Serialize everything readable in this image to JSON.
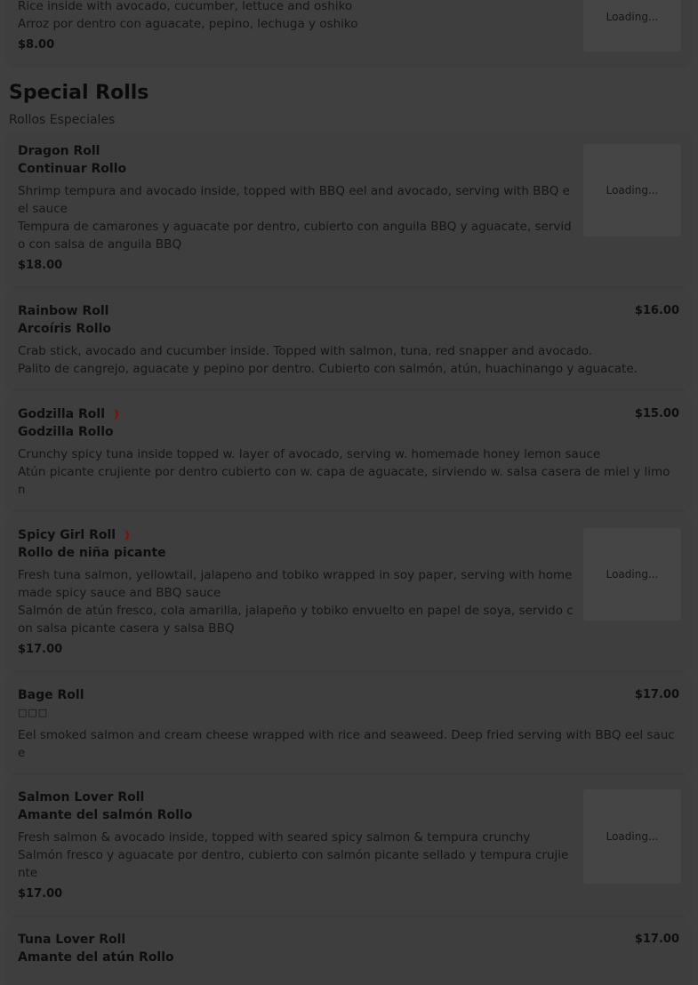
{
  "top_item": {
    "desc_en": "Rice inside with avocado, cucumber, lettuce and oshiko",
    "desc_es": "Arroz por dentro con aguacate, pepino, lechuga y oshiko",
    "price": "$8.00",
    "image_status": "Loading..."
  },
  "section": {
    "title": "Special Rolls",
    "subtitle": "Rollos Especiales"
  },
  "items": [
    {
      "name": "Dragon Roll",
      "name_alt": "Continuar Rollo",
      "desc_en": "Shrimp tempura and avocado inside, topped with BBQ eel and avocado, serving with BBQ eel sauce",
      "desc_es": "Tempura de camarones y aguacate por dentro, cubierto con anguila BBQ y aguacate, servido con salsa de anguila BBQ",
      "price": "$18.00",
      "image_status": "Loading..."
    },
    {
      "name": "Rainbow Roll",
      "name_alt": "Arcoíris Rollo",
      "desc_en": "Crab stick, avocado and cucumber inside. Topped with salmon, tuna, red snapper and avocado.",
      "desc_es": "Palito de cangrejo, aguacate y pepino por dentro. Cubierto con salmón, atún, huachinango y aguacate.",
      "price": "$16.00"
    },
    {
      "name": "Godzilla Roll",
      "name_alt": "Godzilla Rollo",
      "spicy": true,
      "desc_en": "Crunchy spicy tuna inside topped w. layer of avocado, serving w. homemade honey lemon sauce",
      "desc_es": "Atún picante crujiente por dentro cubierto con w. capa de aguacate, sirviendo w. salsa casera de miel y limon",
      "price": "$15.00"
    },
    {
      "name": "Spicy Girl Roll",
      "name_alt": "Rollo de niña picante",
      "spicy": true,
      "desc_en": "Fresh tuna salmon, yellowtail, jalapeno and tobiko wrapped in soy paper, serving with homemade spicy sauce and BBQ sauce",
      "desc_es": "Salmón de atún fresco, cola amarilla, jalapeño y tobiko envuelto en papel de soya, servido con salsa picante casera y salsa BBQ",
      "price": "$17.00",
      "image_status": "Loading..."
    },
    {
      "name": "Bage Roll",
      "name_alt": "□□□",
      "desc_en": "Eel smoked salmon and cream cheese wrapped with rice and seaweed. Deep fried serving with BBQ eel sauce",
      "price": "$17.00"
    },
    {
      "name": "Salmon Lover Roll",
      "name_alt": "Amante del salmón Rollo",
      "desc_en": "Fresh salmon & avocado inside, topped with seared spicy salmon & tempura crunchy",
      "desc_es": "Salmón fresco y aguacate por dentro, cubierto con salmón picante sellado y tempura crujiente",
      "price": "$17.00",
      "image_status": "Loading..."
    },
    {
      "name": "Tuna Lover Roll",
      "name_alt": "Amante del atún Rollo",
      "price": "$17.00"
    }
  ],
  "colors": {
    "overlay": "#404040",
    "chili": "#6b1a10"
  },
  "icons": {
    "spicy": "chili-pepper-icon"
  }
}
